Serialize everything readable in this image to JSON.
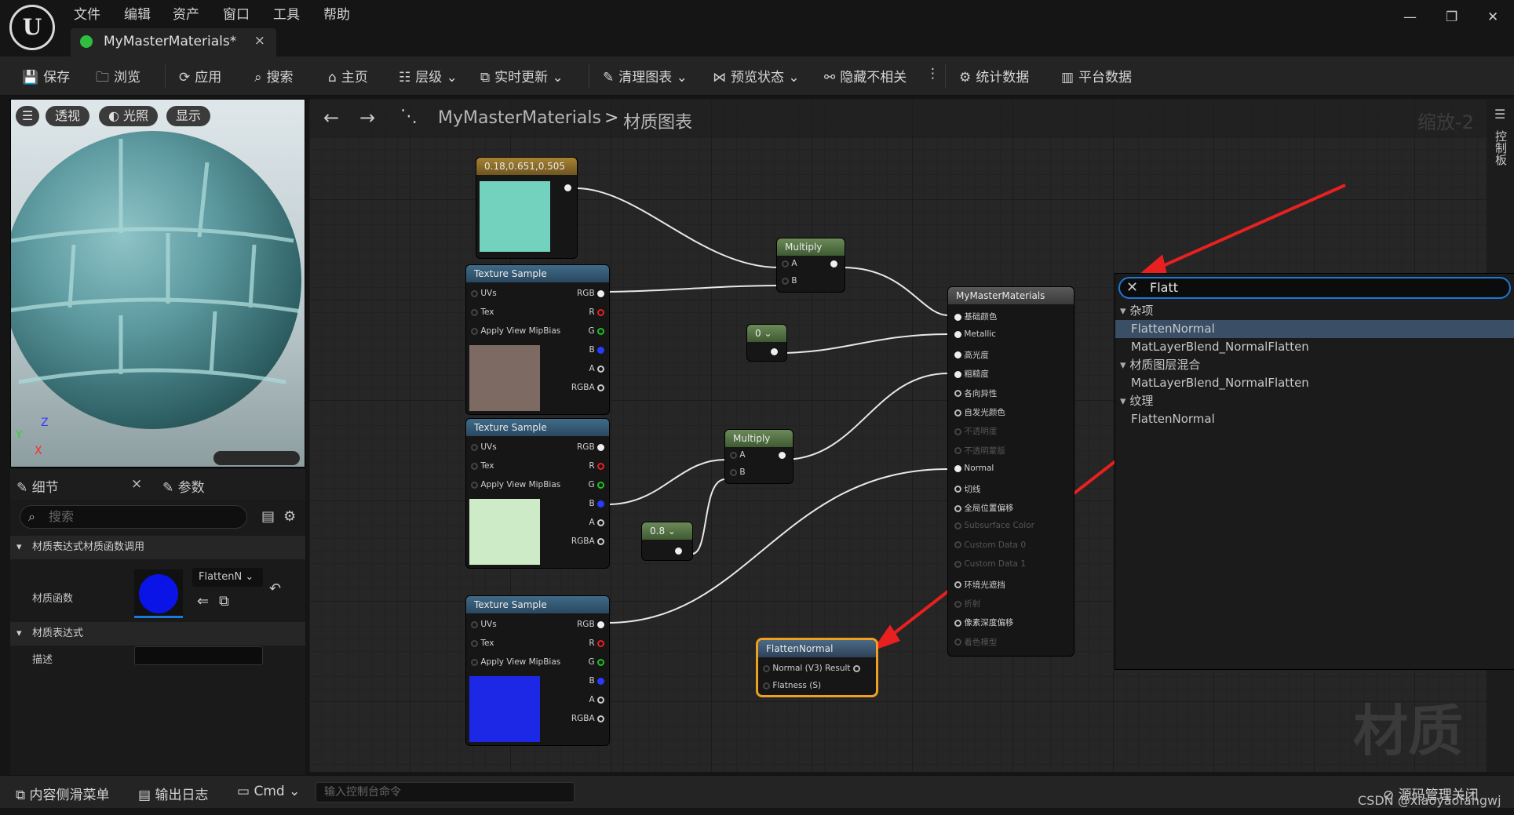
{
  "menu": [
    "文件",
    "编辑",
    "资产",
    "窗口",
    "工具",
    "帮助"
  ],
  "app_tab": {
    "title": "MyMasterMaterials*",
    "close": "×"
  },
  "window_controls": {
    "minimize": "—",
    "restore": "❐",
    "close": "✕"
  },
  "toolbar": {
    "save": "保存",
    "browse": "浏览",
    "apply": "应用",
    "search": "搜索",
    "home": "主页",
    "hierarchy": "层级",
    "live_update": "实时更新",
    "clean_graph": "清理图表",
    "preview_state": "预览状态",
    "hide_unrelated": "隐藏不相关",
    "stats": "统计数据",
    "platform_stats": "平台数据"
  },
  "viewport": {
    "perspective": "透视",
    "lit": "光照",
    "show": "显示",
    "axis_z": "Z",
    "axis_y": "Y",
    "axis_x": "X"
  },
  "details_tabs": {
    "details": "细节",
    "params": "参数",
    "close": "×"
  },
  "details": {
    "search_placeholder": "搜索",
    "section_call": "材质表达式材质函数调用",
    "material_function_label": "材质函数",
    "material_function_value": "FlattenN",
    "section_expr": "材质表达式",
    "desc_label": "描述"
  },
  "graph": {
    "breadcrumb_root": "MyMasterMaterials",
    "breadcrumb_sep": ">",
    "breadcrumb_leaf": "材质图表",
    "zoom": "缩放-2",
    "side_tab": "控制板",
    "watermark": "材质"
  },
  "nodes": {
    "color_const": {
      "title": "0.18,0.651,0.505",
      "swatch": "#72d2bd"
    },
    "texture_pins": [
      "UVs",
      "Tex",
      "Apply View MipBias"
    ],
    "texture_outs": [
      "RGB",
      "R",
      "G",
      "B",
      "A",
      "RGBA"
    ],
    "tex1": {
      "title": "Texture Sample"
    },
    "tex2": {
      "title": "Texture Sample"
    },
    "tex3": {
      "title": "Texture Sample"
    },
    "multiply1": {
      "title": "Multiply",
      "a": "A",
      "b": "B"
    },
    "multiply2": {
      "title": "Multiply",
      "a": "A",
      "b": "B"
    },
    "const0": {
      "title": "0"
    },
    "const08": {
      "title": "0.8"
    },
    "flatten": {
      "title": "FlattenNormal",
      "in1": "Normal (V3)",
      "out1": "Result",
      "in2": "Flatness (S)"
    },
    "master": {
      "title": "MyMasterMaterials",
      "pins": [
        {
          "label": "基础颜色",
          "active": true
        },
        {
          "label": "Metallic",
          "active": true
        },
        {
          "label": "高光度",
          "active": true
        },
        {
          "label": "粗糙度",
          "active": true
        },
        {
          "label": "各向异性",
          "active": true
        },
        {
          "label": "自发光颜色",
          "active": true
        },
        {
          "label": "不透明度",
          "active": false
        },
        {
          "label": "不透明蒙版",
          "active": false
        },
        {
          "label": "Normal",
          "active": true
        },
        {
          "label": "切线",
          "active": true
        },
        {
          "label": "全局位置偏移",
          "active": true
        },
        {
          "label": "Subsurface Color",
          "active": false
        },
        {
          "label": "Custom Data 0",
          "active": false
        },
        {
          "label": "Custom Data 1",
          "active": false
        },
        {
          "label": "环境光遮挡",
          "active": true
        },
        {
          "label": "折射",
          "active": false
        },
        {
          "label": "像素深度偏移",
          "active": true
        },
        {
          "label": "着色模型",
          "active": false
        }
      ]
    }
  },
  "search_popup": {
    "query": "Flatt",
    "rows": [
      {
        "kind": "cat",
        "label": "杂项"
      },
      {
        "kind": "item",
        "label": "FlattenNormal",
        "selected": true
      },
      {
        "kind": "item",
        "label": "MatLayerBlend_NormalFlatten"
      },
      {
        "kind": "cat",
        "label": "材质图层混合"
      },
      {
        "kind": "item",
        "label": "MatLayerBlend_NormalFlatten"
      },
      {
        "kind": "cat",
        "label": "纹理"
      },
      {
        "kind": "item",
        "label": "FlattenNormal"
      }
    ]
  },
  "bottom": {
    "content_drawer": "内容侧滑菜单",
    "output_log": "输出日志",
    "cmd": "Cmd",
    "console_placeholder": "输入控制台命令",
    "source_control": "源码管理关闭",
    "credit": "CSDN @xiaoyaofangwj"
  },
  "colors": {
    "accent_blue": "#1d78d6",
    "node_selected": "#f0a020",
    "arrow_red": "#e82020"
  }
}
